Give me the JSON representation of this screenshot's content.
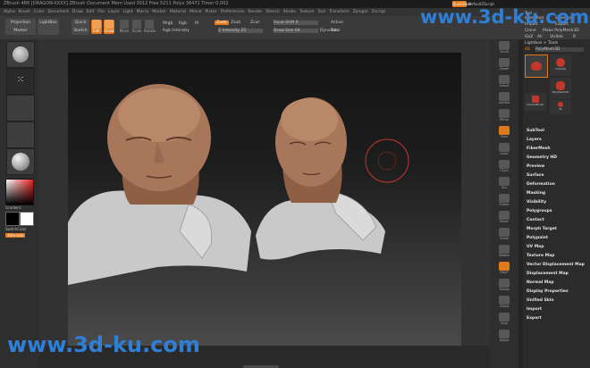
{
  "titlebar": {
    "text": "ZBrush 4R6 [DRAGON-XXXX] ZBrush Document    Mem Used 3012 Free 5211 Polys 36471   Timer 0.002",
    "quicksave_label": "QuickSave",
    "default_script_label": "DefaultZScript"
  },
  "menubar": {
    "items": [
      "Alpha",
      "Brush",
      "Color",
      "Document",
      "Draw",
      "Edit",
      "File",
      "Layer",
      "Light",
      "Macro",
      "Marker",
      "Material",
      "Movie",
      "Picker",
      "Preferences",
      "Render",
      "Stencil",
      "Stroke",
      "Texture",
      "Tool",
      "Transform",
      "Zplugin",
      "Zscript"
    ]
  },
  "toolbar": {
    "projection_master": "Projection Master",
    "lightbox": "LightBox",
    "quick_sketch": "Quick Sketch",
    "edit": "Edit",
    "draw": "Draw",
    "move": "Move",
    "scale": "Scale",
    "rotate": "Rotate",
    "mrgb": "Mrgb",
    "rgb": "Rgb",
    "m": "M",
    "zadd": "Zadd",
    "zsub": "Zsub",
    "zcut": "Zcut",
    "rgb_intensity": "Rgb Intensity",
    "z_intensity": "Z Intensity 25",
    "focal_shift": "Focal Shift 0",
    "draw_size": "Draw Size 64",
    "active_points": "Active",
    "total_points": "Total",
    "dynamic": "Dynamic"
  },
  "left_shelf": {
    "gradient_label": "Gradient",
    "switch_color_label": "SwitchColor",
    "alternate_label": "Alternate"
  },
  "right_shelf": {
    "tools": [
      "Scroll",
      "Zoom",
      "Actual",
      "AAHalf",
      "Persp",
      "Floor",
      "Local",
      "LSym",
      "Xyz",
      "Frame",
      "Move",
      "Scale",
      "Rotate",
      "PolyF",
      "Transp",
      "Ghost",
      "Solo",
      "Xpose"
    ]
  },
  "tool_panel": {
    "header": "Tool",
    "load_tool": "Load Tool",
    "save_as": "Save As",
    "import": "Import",
    "export": "Export",
    "clone": "Clone",
    "make_polymesh": "Make PolyMesh3D",
    "goz": "GoZ",
    "all": "All",
    "visible": "Visible",
    "r": "R",
    "lightbox_tools": "Lightbox > Tools",
    "current_tool_value": "PolyMesh3D",
    "current_tool_number": "48",
    "thumb_labels": [
      "Cube3D",
      "PolyMesh3D",
      "SimpleBrush",
      "Sk"
    ],
    "sections": [
      "SubTool",
      "Layers",
      "FiberMesh",
      "Geometry HD",
      "Preview",
      "Surface",
      "Deformation",
      "Masking",
      "Visibility",
      "Polygroups",
      "Contact",
      "Morph Target",
      "Polypaint",
      "UV Map",
      "Texture Map",
      "Vector Displacement Map",
      "Displacement Map",
      "Normal Map",
      "Display Properties",
      "Unified Skin",
      "Import",
      "Export"
    ]
  },
  "canvas": {
    "background_top": "#141414",
    "background_bottom": "#4a4a4a",
    "skin_color": "#a8765a",
    "clay_color": "#c9c9c9"
  },
  "watermarks": {
    "top": "www.3d-ku.com",
    "bottom": "www.3d-ku.com"
  },
  "colors": {
    "accent_orange": "#e0781e",
    "menu_text": "#e6e6e6",
    "watermark_blue": "#2f7fd6"
  }
}
